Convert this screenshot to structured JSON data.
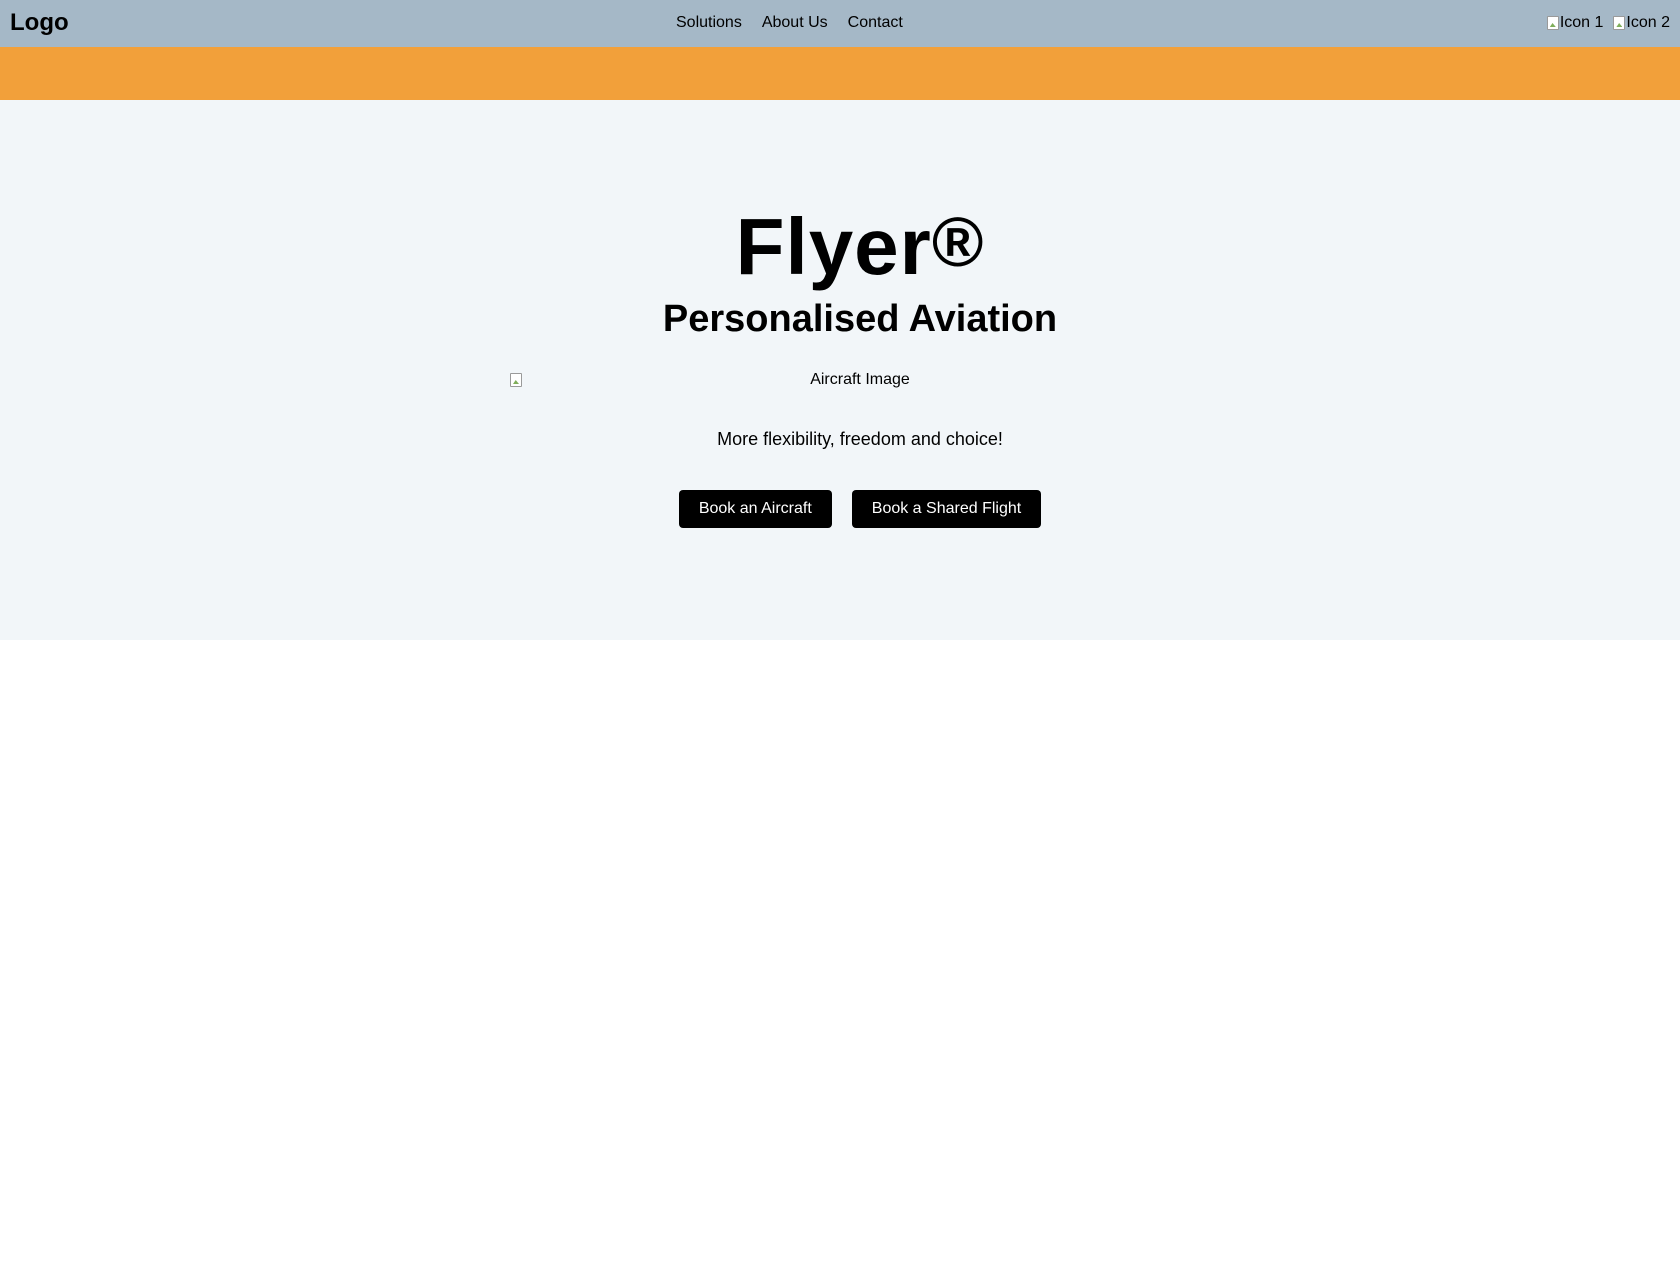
{
  "header": {
    "logo": "Logo",
    "nav": [
      "Solutions",
      "About Us",
      "Contact"
    ],
    "icons": [
      {
        "alt": "Icon 1",
        "icon": "broken-image-icon"
      },
      {
        "alt": "Icon 2",
        "icon": "broken-image-icon"
      }
    ]
  },
  "hero": {
    "title": "Flyer",
    "title_mark": "®",
    "subtitle": "Personalised Aviation",
    "image_alt": "Aircraft Image",
    "tagline": "More flexibility, freedom and choice!",
    "buttons": [
      "Book an Aircraft",
      "Book a Shared Flight"
    ]
  },
  "colors": {
    "header_bg": "#a5b8c7",
    "accent_band": "#f2a03a",
    "hero_bg": "#f2f6f9",
    "button_bg": "#000000",
    "button_text": "#ffffff"
  }
}
